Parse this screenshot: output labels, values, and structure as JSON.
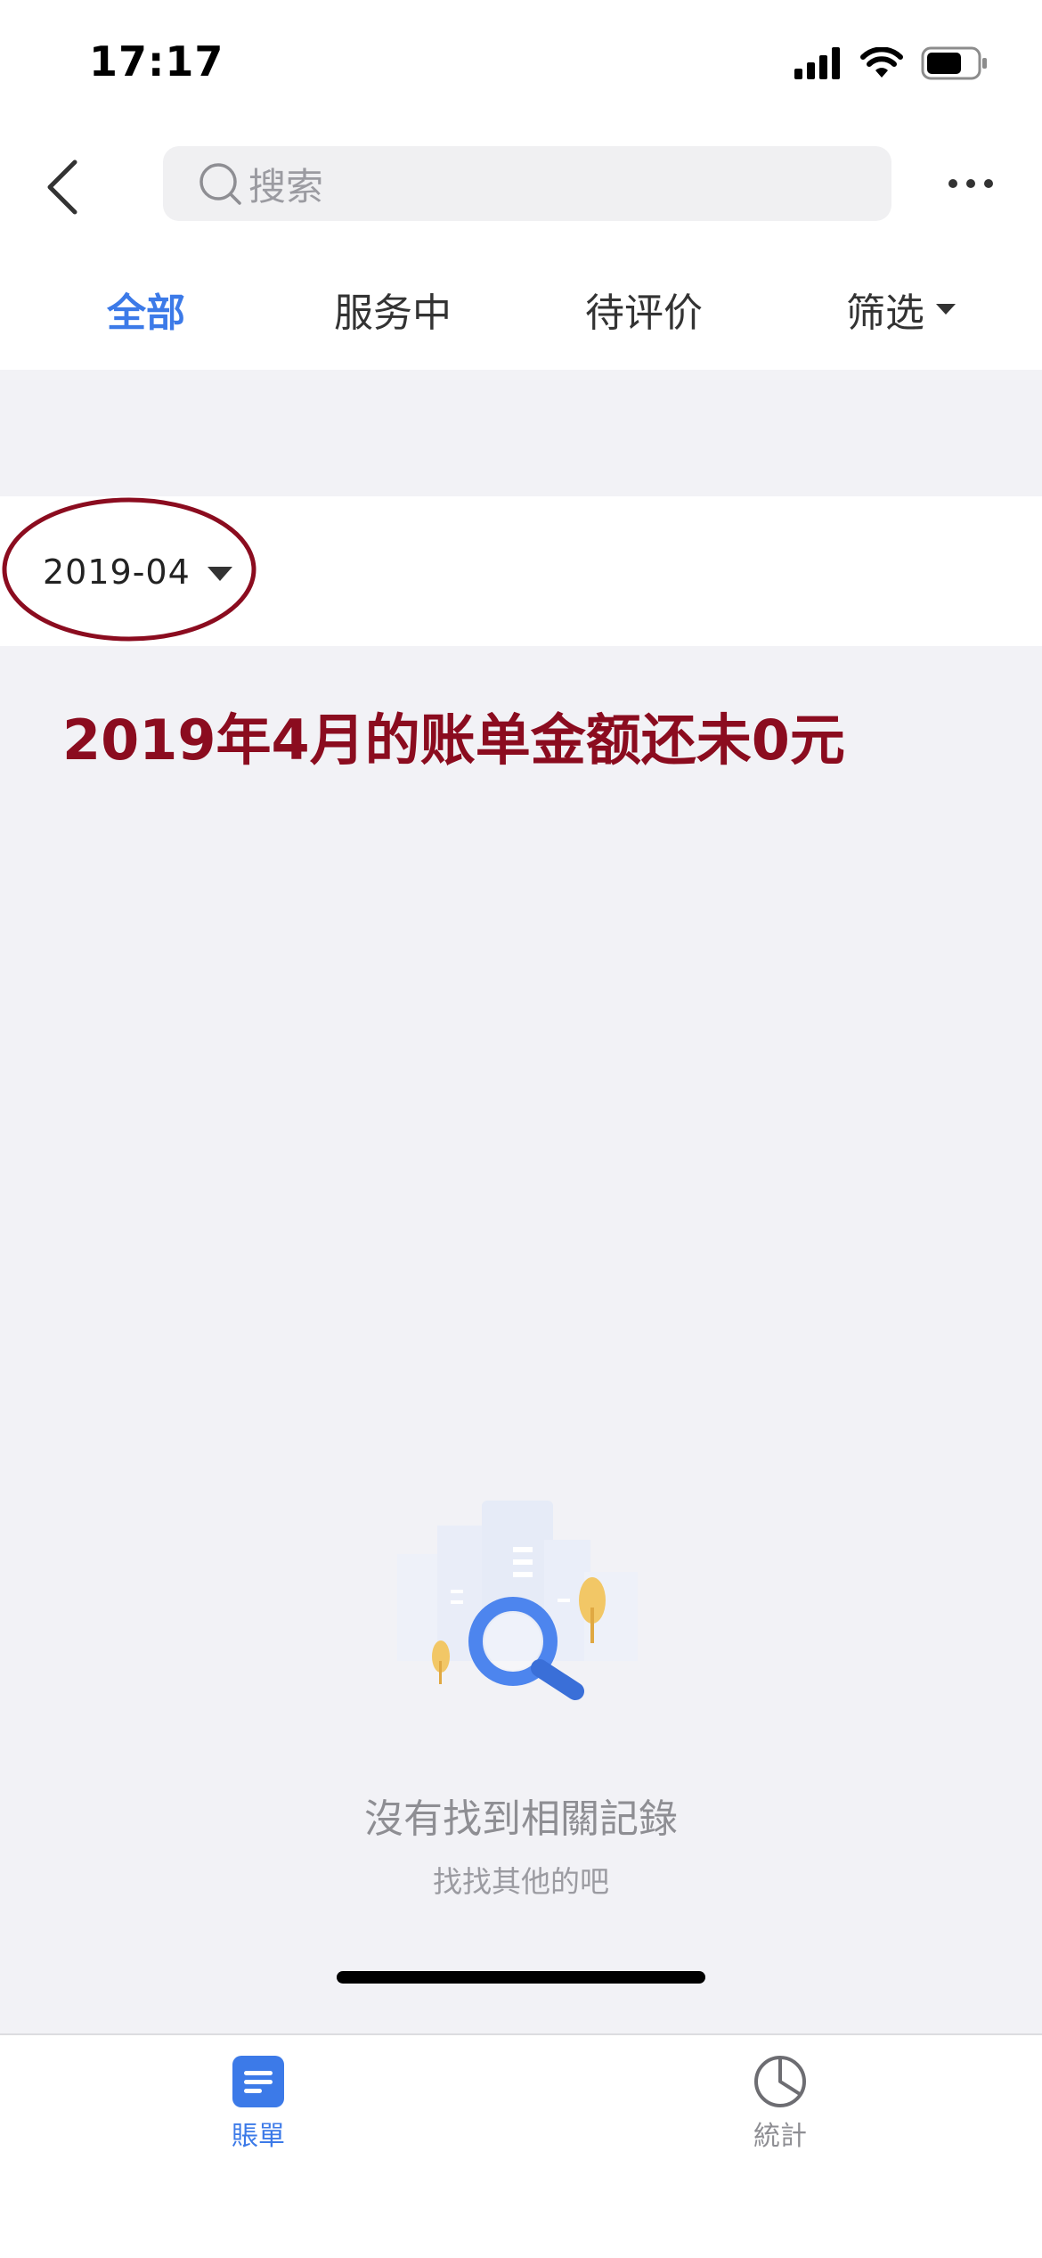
{
  "status_bar": {
    "time": "17:17"
  },
  "search": {
    "placeholder": "搜索"
  },
  "tabs": [
    {
      "label": "全部",
      "active": true
    },
    {
      "label": "服务中",
      "active": false
    },
    {
      "label": "待评价",
      "active": false
    },
    {
      "label": "筛选",
      "active": false
    }
  ],
  "month_selector": {
    "value": "2019-04"
  },
  "annotation": {
    "text": "2019年4月的账单金额还未0元"
  },
  "empty_state": {
    "title": "沒有找到相關記錄",
    "subtitle": "找找其他的吧"
  },
  "bottom_nav": [
    {
      "label": "賬單",
      "icon": "bill-icon",
      "active": true
    },
    {
      "label": "統計",
      "icon": "pie-chart-icon",
      "active": false
    }
  ],
  "colors": {
    "accent": "#3c7ae8",
    "annotation": "#8b0c1f",
    "background": "#f2f2f6"
  }
}
